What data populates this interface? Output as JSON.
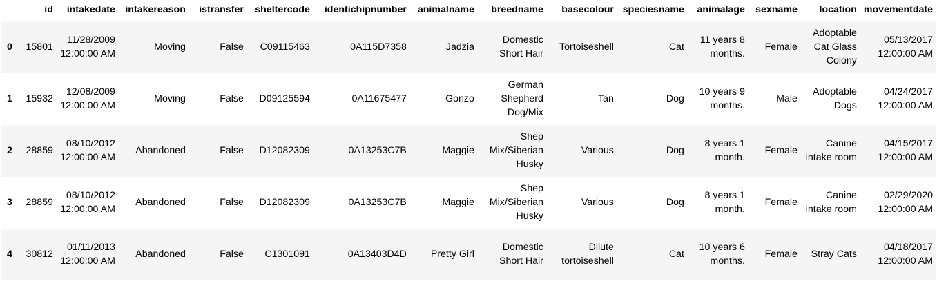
{
  "table": {
    "columns": [
      "",
      "id",
      "intakedate",
      "intakereason",
      "istransfer",
      "sheltercode",
      "identichipnumber",
      "animalname",
      "breedname",
      "basecolour",
      "speciesname",
      "animalage",
      "sexname",
      "location",
      "movementdate"
    ],
    "rows": [
      {
        "index": "0",
        "id": "15801",
        "intakedate": "11/28/2009 12:00:00 AM",
        "intakereason": "Moving",
        "istransfer": "False",
        "sheltercode": "C09115463",
        "identichipnumber": "0A115D7358",
        "animalname": "Jadzia",
        "breedname": "Domestic Short Hair",
        "basecolour": "Tortoiseshell",
        "speciesname": "Cat",
        "animalage": "11 years 8 months.",
        "sexname": "Female",
        "location": "Adoptable Cat Glass Colony",
        "movementdate": "05/13/2017 12:00:00 AM"
      },
      {
        "index": "1",
        "id": "15932",
        "intakedate": "12/08/2009 12:00:00 AM",
        "intakereason": "Moving",
        "istransfer": "False",
        "sheltercode": "D09125594",
        "identichipnumber": "0A11675477",
        "animalname": "Gonzo",
        "breedname": "German Shepherd Dog/Mix",
        "basecolour": "Tan",
        "speciesname": "Dog",
        "animalage": "10 years 9 months.",
        "sexname": "Male",
        "location": "Adoptable Dogs",
        "movementdate": "04/24/2017 12:00:00 AM"
      },
      {
        "index": "2",
        "id": "28859",
        "intakedate": "08/10/2012 12:00:00 AM",
        "intakereason": "Abandoned",
        "istransfer": "False",
        "sheltercode": "D12082309",
        "identichipnumber": "0A13253C7B",
        "animalname": "Maggie",
        "breedname": "Shep Mix/Siberian Husky",
        "basecolour": "Various",
        "speciesname": "Dog",
        "animalage": "8 years 1 month.",
        "sexname": "Female",
        "location": "Canine intake room",
        "movementdate": "04/15/2017 12:00:00 AM"
      },
      {
        "index": "3",
        "id": "28859",
        "intakedate": "08/10/2012 12:00:00 AM",
        "intakereason": "Abandoned",
        "istransfer": "False",
        "sheltercode": "D12082309",
        "identichipnumber": "0A13253C7B",
        "animalname": "Maggie",
        "breedname": "Shep Mix/Siberian Husky",
        "basecolour": "Various",
        "speciesname": "Dog",
        "animalage": "8 years 1 month.",
        "sexname": "Female",
        "location": "Canine intake room",
        "movementdate": "02/29/2020 12:00:00 AM"
      },
      {
        "index": "4",
        "id": "30812",
        "intakedate": "01/11/2013 12:00:00 AM",
        "intakereason": "Abandoned",
        "istransfer": "False",
        "sheltercode": "C1301091",
        "identichipnumber": "0A13403D4D",
        "animalname": "Pretty Girl",
        "breedname": "Domestic Short Hair",
        "basecolour": "Dilute tortoiseshell",
        "speciesname": "Cat",
        "animalage": "10 years 6 months.",
        "sexname": "Female",
        "location": "Stray Cats",
        "movementdate": "04/18/2017 12:00:00 AM"
      }
    ]
  }
}
